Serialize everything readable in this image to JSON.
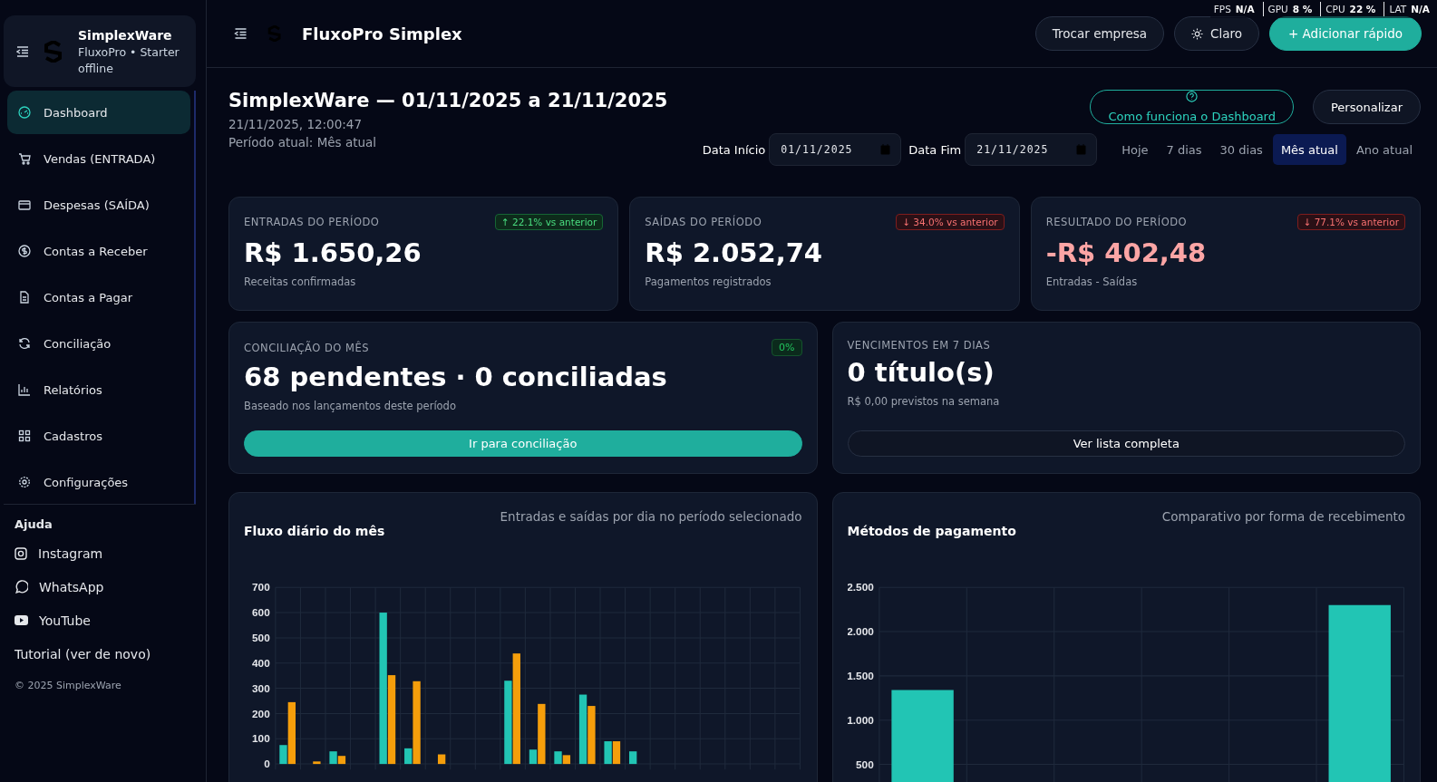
{
  "sidebar": {
    "brand": {
      "name": "SimplexWare",
      "plan": "FluxoPro • Starter",
      "status": "offline"
    },
    "items": [
      {
        "label": "Dashboard",
        "selected": true
      },
      {
        "label": "Vendas (ENTRADA)",
        "selected": false
      },
      {
        "label": "Despesas (SAÍDA)",
        "selected": false
      },
      {
        "label": "Contas a Receber",
        "selected": false
      },
      {
        "label": "Contas a Pagar",
        "selected": false
      },
      {
        "label": "Conciliação",
        "selected": false
      },
      {
        "label": "Relatórios",
        "selected": false
      },
      {
        "label": "Cadastros",
        "selected": false
      },
      {
        "label": "Configurações",
        "selected": false
      }
    ],
    "help": {
      "title": "Ajuda",
      "links": [
        {
          "label": "Instagram"
        },
        {
          "label": "WhatsApp"
        },
        {
          "label": "YouTube"
        },
        {
          "label": "Tutorial (ver de novo)"
        }
      ]
    },
    "footer": "© 2025 SimplexWare"
  },
  "header": {
    "title": "FluxoPro Simplex",
    "buttons": [
      {
        "label": "Trocar empresa",
        "kind": "plain"
      },
      {
        "label": "Claro",
        "kind": "theme"
      },
      {
        "label": "+ Adicionar rápido",
        "kind": "primary"
      }
    ]
  },
  "perf_overlay": [
    {
      "label": "FPS",
      "value": "N/A"
    },
    {
      "label": "GPU",
      "value": "8 %"
    },
    {
      "label": "CPU",
      "value": "22 %"
    },
    {
      "label": "LAT",
      "value": "N/A"
    }
  ],
  "page": {
    "title": "SimplexWare — 01/11/2025 a 21/11/2025",
    "timestamp": "21/11/2025, 12:00:47",
    "period": "Período atual: Mês atual",
    "actions": [
      {
        "label": "Como funciona o Dashboard",
        "kind": "help"
      },
      {
        "label": "Personalizar",
        "kind": "plain"
      }
    ],
    "date_start": {
      "label": "Data Início",
      "value": "01/11/2025"
    },
    "date_end": {
      "label": "Data Fim",
      "value": "21/11/2025"
    },
    "ranges": [
      {
        "label": "Hoje",
        "selected": false
      },
      {
        "label": "7 dias",
        "selected": false
      },
      {
        "label": "30 dias",
        "selected": false
      },
      {
        "label": "Mês atual",
        "selected": true
      },
      {
        "label": "Ano atual",
        "selected": false
      }
    ]
  },
  "stats": [
    {
      "label": "ENTRADAS DO PERÍODO",
      "delta": "↑ 22.1% vs anterior",
      "kind": "gain",
      "value": "R$ 1.650,26",
      "sub": "Receitas confirmadas"
    },
    {
      "label": "SAÍDAS DO PERÍODO",
      "delta": "↓ 34.0% vs anterior",
      "kind": "loss",
      "value": "R$ 2.052,74",
      "sub": "Pagamentos registrados"
    },
    {
      "label": "RESULTADO DO PERÍODO",
      "delta": "↓ 77.1% vs anterior",
      "kind": "deficit",
      "value": "-R$ 402,48",
      "sub": "Entradas - Saídas"
    }
  ],
  "cards": [
    {
      "label": "CONCILIAÇÃO DO MÊS",
      "badge": "0%",
      "value": "68 pendentes · 0 conciliadas",
      "sub": "Baseado nos lançamentos deste período",
      "button": "Ir para conciliação",
      "kind": "primary"
    },
    {
      "label": "VENCIMENTOS EM 7 DIAS",
      "value": "0 título(s)",
      "sub": "R$ 0,00 previstos na semana",
      "button": "Ver lista completa",
      "kind": "outline"
    }
  ],
  "charts": [
    {
      "title": "Fluxo diário do mês",
      "subtitle": "Entradas e saídas por dia no período selecionado",
      "chart_data": {
        "type": "bar",
        "grid": true,
        "ylim": [
          0,
          700
        ],
        "yticks": [
          0,
          100,
          200,
          300,
          400,
          500,
          600,
          700
        ],
        "series": [
          {
            "color": "#22c5b4",
            "values": [
              75,
              0,
              50,
              0,
              600,
              62,
              0,
              0,
              0,
              330,
              57,
              50,
              275,
              90,
              50,
              0,
              0,
              0,
              0,
              0,
              0
            ]
          },
          {
            "color": "#f59e0b",
            "values": [
              245,
              10,
              32,
              0,
              352,
              328,
              38,
              0,
              0,
              438,
              238,
              35,
              230,
              90,
              0,
              0,
              0,
              0,
              0,
              0,
              0
            ]
          }
        ]
      }
    },
    {
      "title": "Métodos de pagamento",
      "subtitle": "Comparativo por forma de recebimento",
      "chart_data": {
        "type": "bar",
        "grid": true,
        "ylim": [
          0,
          2500
        ],
        "yticks": [
          {
            "value": 500,
            "label": "500"
          },
          {
            "value": 1000,
            "label": "1.000"
          },
          {
            "value": 1500,
            "label": "1.500"
          },
          {
            "value": 2000,
            "label": "2.000"
          },
          {
            "value": 2500,
            "label": "2.500"
          }
        ],
        "series": [
          {
            "color": "#22c5b4",
            "values": [
              1340,
              0,
              0,
              0,
              0,
              2300
            ]
          }
        ]
      }
    }
  ]
}
